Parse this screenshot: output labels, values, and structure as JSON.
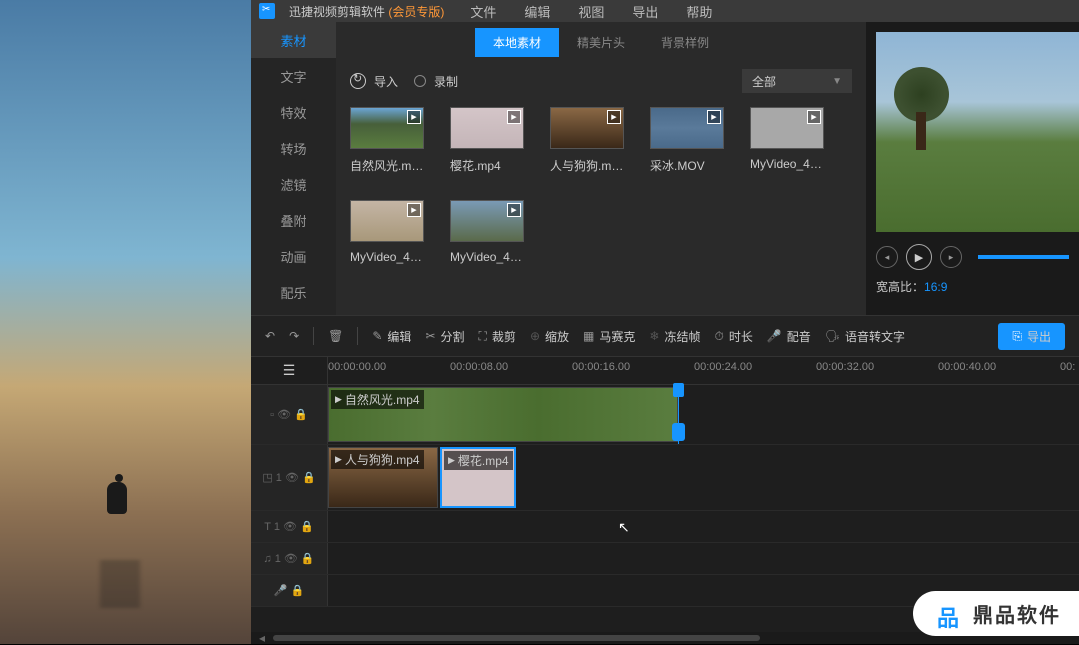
{
  "titlebar": {
    "name": "迅捷视频剪辑软件",
    "vip": " (会员专版)"
  },
  "menus": [
    "文件",
    "编辑",
    "视图",
    "导出",
    "帮助"
  ],
  "sidebar": [
    "素材",
    "文字",
    "特效",
    "转场",
    "滤镜",
    "叠附",
    "动画",
    "配乐"
  ],
  "subtabs": [
    "本地素材",
    "精美片头",
    "背景样例"
  ],
  "import_label": "导入",
  "record_label": "录制",
  "filter_label": "全部",
  "media": [
    {
      "name": "自然风光.mp4",
      "cls": "nature"
    },
    {
      "name": "樱花.mp4",
      "cls": "cherry"
    },
    {
      "name": "人与狗狗.mp4",
      "cls": "person"
    },
    {
      "name": "采冰.MOV",
      "cls": "ice"
    },
    {
      "name": "MyVideo_4_...",
      "cls": "grey"
    },
    {
      "name": "MyVideo_4_...",
      "cls": "field"
    },
    {
      "name": "MyVideo_4_...",
      "cls": "road"
    }
  ],
  "aspect": {
    "label": "宽高比：",
    "value": "16:9"
  },
  "toolbar": {
    "edit": "编辑",
    "split": "分割",
    "crop": "裁剪",
    "zoom": "缩放",
    "mosaic": "马赛克",
    "freeze": "冻结帧",
    "duration": "时长",
    "audio": "配音",
    "stt": "语音转文字",
    "export": "导出"
  },
  "timecodes": [
    "00:00:00.00",
    "00:00:08.00",
    "00:00:16.00",
    "00:00:24.00",
    "00:00:32.00",
    "00:00:40.00",
    "00:"
  ],
  "clips": {
    "main": "自然风光.mp4",
    "pip1": "人与狗狗.mp4",
    "pip2": "樱花.mp4"
  },
  "watermark": "鼎品软件"
}
